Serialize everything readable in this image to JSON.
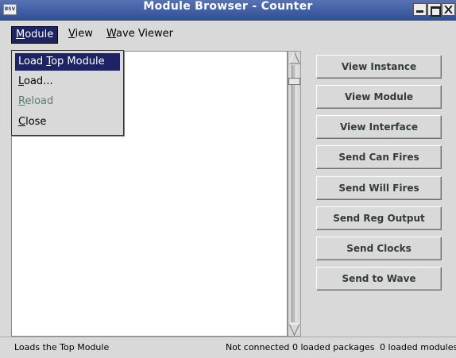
{
  "window": {
    "title": "Module Browser - Counter",
    "app_icon_text": "BSV"
  },
  "menubar": {
    "items": [
      {
        "label_mnemonic": "M",
        "label_rest": "odule"
      },
      {
        "label_mnemonic": "V",
        "label_rest": "iew"
      },
      {
        "label_mnemonic": "W",
        "label_rest": "ave Viewer"
      }
    ]
  },
  "module_menu": {
    "items": [
      {
        "label_before": "Load ",
        "label_mnemonic": "T",
        "label_after": "op Module",
        "state": "highlighted"
      },
      {
        "label_before": "",
        "label_mnemonic": "L",
        "label_after": "oad...",
        "state": "enabled"
      },
      {
        "label_before": "",
        "label_mnemonic": "R",
        "label_after": "eload",
        "state": "disabled"
      },
      {
        "label_before": "",
        "label_mnemonic": "C",
        "label_after": "lose",
        "state": "enabled"
      }
    ]
  },
  "actions": {
    "buttons": [
      "View Instance",
      "View Module",
      "View Interface",
      "Send Can Fires",
      "Send Will Fires",
      "Send Reg Output",
      "Send Clocks",
      "Send to Wave"
    ]
  },
  "statusbar": {
    "message": "Loads the Top Module",
    "connection": "Not connected",
    "packages": "0 loaded packages",
    "modules": "0 loaded modules"
  },
  "colors": {
    "titlebar": "#3b5aa1",
    "highlight": "#1c2466",
    "button_text": "#333a3a",
    "disabled_text": "#5c7a70"
  }
}
